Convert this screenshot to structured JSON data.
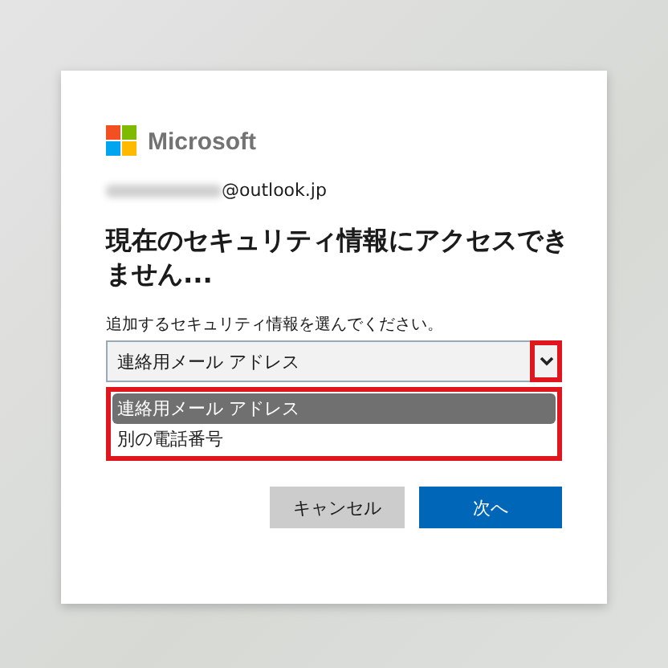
{
  "brand": {
    "name": "Microsoft"
  },
  "account": {
    "email_visible": "@outlook.jp"
  },
  "heading": "現在のセキュリティ情報にアクセスできません...",
  "select": {
    "label": "追加するセキュリティ情報を選んでください。",
    "value": "連絡用メール アドレス",
    "expanded": true,
    "options": [
      {
        "label": "連絡用メール アドレス",
        "selected": true
      },
      {
        "label": "別の電話番号",
        "selected": false
      }
    ]
  },
  "buttons": [
    {
      "label": "キャンセル",
      "kind": "secondary"
    },
    {
      "label": "次へ",
      "kind": "primary"
    }
  ]
}
